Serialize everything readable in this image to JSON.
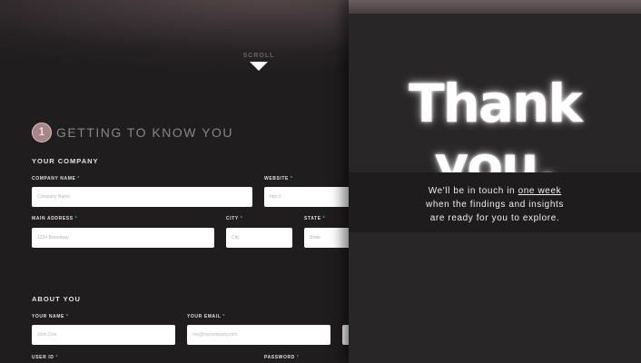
{
  "scroll": {
    "label": "SCROLL"
  },
  "step": {
    "number": "1",
    "title": "GETTING TO KNOW YOU"
  },
  "company_section": {
    "title": "YOUR COMPANY",
    "company_name": {
      "label": "COMPANY NAME",
      "required": "*",
      "placeholder": "Company Name"
    },
    "website": {
      "label": "WEBSITE",
      "required": "*",
      "placeholder": "http://"
    },
    "main_address": {
      "label": "MAIN ADDRESS",
      "required": "*",
      "placeholder": "1234 Broadway"
    },
    "city": {
      "label": "CITY",
      "required": "*",
      "placeholder": "City"
    },
    "state": {
      "label": "STATE",
      "required": "*",
      "placeholder": "State"
    }
  },
  "about_section": {
    "title": "ABOUT YOU",
    "your_name": {
      "label": "YOUR NAME",
      "required": "*",
      "placeholder": "John Doe"
    },
    "your_email": {
      "label": "YOUR EMAIL",
      "required": "*",
      "placeholder": "me@mycompany.com"
    },
    "user_id": {
      "label": "USER ID",
      "required": "*"
    },
    "password": {
      "label": "PASSWORD",
      "required": "*"
    }
  },
  "thanks": {
    "heading": "Thank you.",
    "line1_prefix": "We'll be in touch in ",
    "line1_highlight": "one week",
    "line2": "when the findings and insights",
    "line3": "are ready for you to explore."
  },
  "colors": {
    "accent": "#4fb09a",
    "step_badge": "#a98588",
    "background": "#1f1d1e"
  }
}
